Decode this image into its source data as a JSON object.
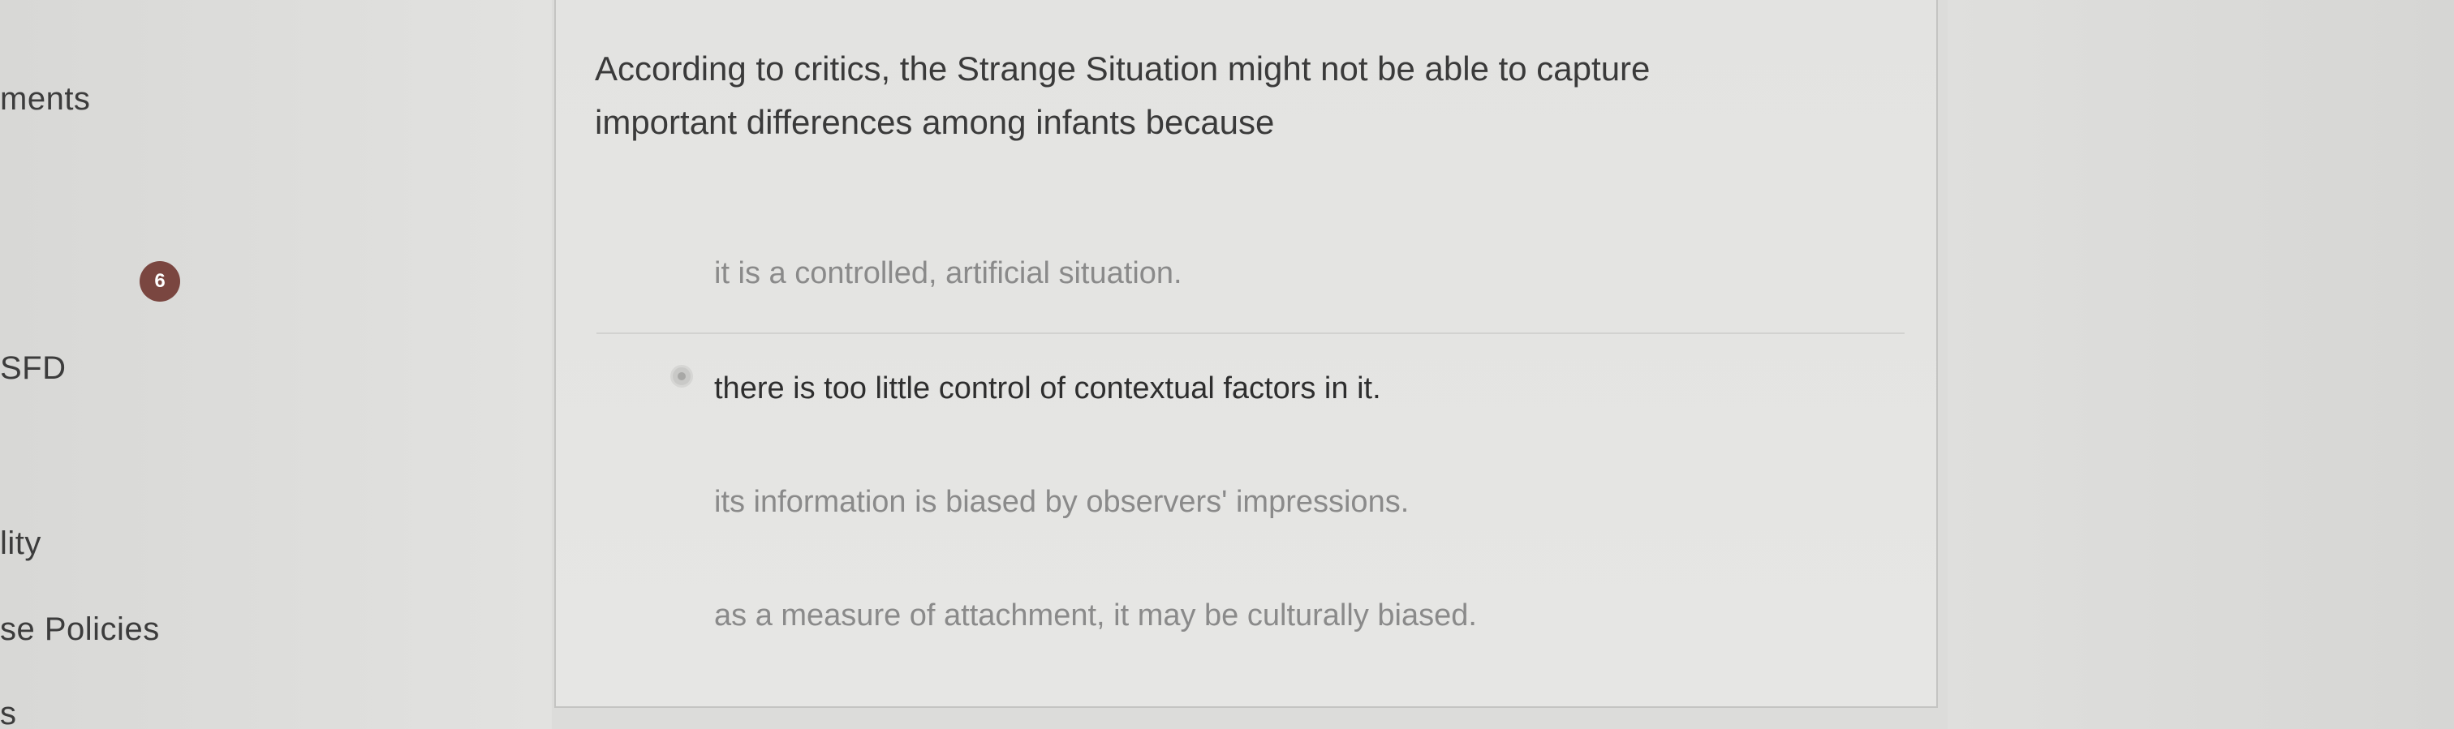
{
  "sidebar": {
    "items": [
      {
        "label": "ments"
      },
      {
        "label": "SFD"
      },
      {
        "label": "lity"
      },
      {
        "label": "se Policies"
      },
      {
        "label": "s"
      }
    ],
    "badge": "6"
  },
  "quiz": {
    "question": "According to critics, the Strange Situation might not be able to capture important differences among infants because",
    "options": [
      {
        "label": "it is a controlled, artificial situation.",
        "selected": false
      },
      {
        "label": "there is too little control of contextual factors in it.",
        "selected": true
      },
      {
        "label": "its information is biased by observers' impressions.",
        "selected": false
      },
      {
        "label": "as a measure of attachment, it may be culturally biased.",
        "selected": false
      }
    ]
  }
}
